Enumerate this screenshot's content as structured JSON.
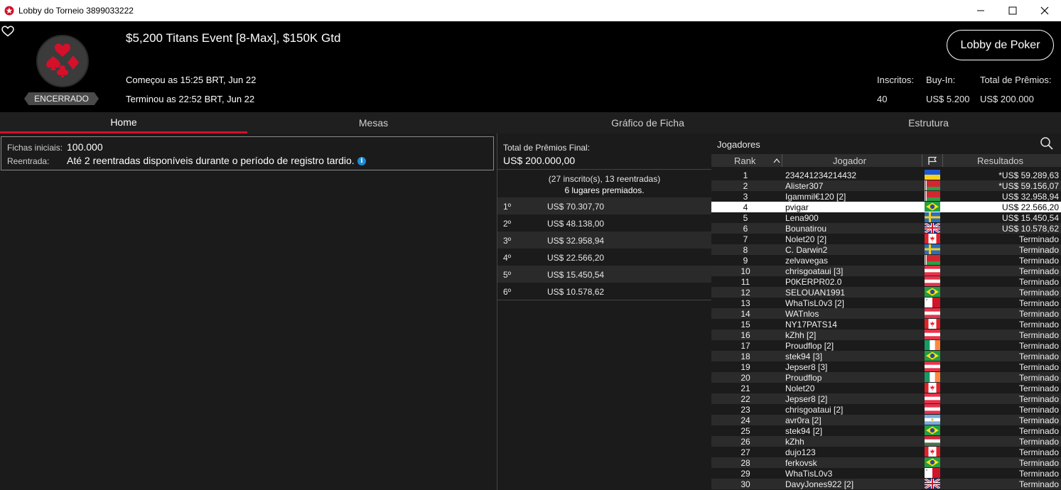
{
  "window": {
    "title": "Lobby do Torneio 3899033222"
  },
  "header": {
    "event_title": "$5,200 Titans Event [8-Max], $150K Gtd",
    "started": "Começou as 15:25 BRT, Jun 22",
    "ended": "Terminou as 22:52 BRT, Jun 22",
    "status": "ENCERRADO",
    "lobby_button": "Lobby de Poker",
    "stats": {
      "entrants_label": "Inscritos:",
      "entrants_value": "40",
      "buyin_label": "Buy-In:",
      "buyin_value": "US$ 5.200",
      "prize_label": "Total de Prêmios:",
      "prize_value": "US$ 200.000"
    }
  },
  "tabs": [
    "Home",
    "Mesas",
    "Gráfico de Ficha",
    "Estrutura"
  ],
  "info": {
    "starting_chips_label": "Fichas iniciais:",
    "starting_chips_value": "100.000",
    "reentry_label": "Reentrada:",
    "reentry_value": "Até 2 reentradas disponíveis durante o período de registro tardio."
  },
  "prizes": {
    "total_label": "Total de Prêmios Final:",
    "total_value": "US$ 200.000,00",
    "info_line1": "(27 inscrito(s), 13 reentradas)",
    "info_line2": "6 lugares premiados.",
    "places": [
      {
        "place": "1º",
        "amount": "US$ 70.307,70"
      },
      {
        "place": "2º",
        "amount": "US$ 48.138,00"
      },
      {
        "place": "3º",
        "amount": "US$ 32.958,94"
      },
      {
        "place": "4º",
        "amount": "US$ 22.566,20"
      },
      {
        "place": "5º",
        "amount": "US$ 15.450,54"
      },
      {
        "place": "6º",
        "amount": "US$ 10.578,62"
      }
    ]
  },
  "players": {
    "title": "Jogadores",
    "columns": {
      "rank": "Rank",
      "player": "Jogador",
      "results": "Resultados"
    },
    "highlight_rank": "4",
    "rows": [
      {
        "rank": "1",
        "name": "234241234214432",
        "flag": "ukraine",
        "result": "*US$ 59.289,63"
      },
      {
        "rank": "2",
        "name": "Alister307",
        "flag": "belarus",
        "result": "*US$ 59.156,07"
      },
      {
        "rank": "3",
        "name": "Igammil€120 [2]",
        "flag": "belarus",
        "result": "US$ 32.958,94"
      },
      {
        "rank": "4",
        "name": "pvigar",
        "flag": "brazil",
        "result": "US$ 22.566,20"
      },
      {
        "rank": "5",
        "name": "Lena900",
        "flag": "sweden",
        "result": "US$ 15.450,54"
      },
      {
        "rank": "6",
        "name": "Bounatirou",
        "flag": "uk",
        "result": "US$ 10.578,62"
      },
      {
        "rank": "7",
        "name": "Nolet20 [2]",
        "flag": "canada",
        "result": "Terminado"
      },
      {
        "rank": "8",
        "name": "C. Darwin2",
        "flag": "sweden",
        "result": "Terminado"
      },
      {
        "rank": "9",
        "name": "zelvavegas",
        "flag": "belarus",
        "result": "Terminado"
      },
      {
        "rank": "10",
        "name": "chrisgoataui [3]",
        "flag": "austria",
        "result": "Terminado"
      },
      {
        "rank": "11",
        "name": "P0KERPR02.0",
        "flag": "austria",
        "result": "Terminado"
      },
      {
        "rank": "12",
        "name": "SELOUAN1991",
        "flag": "brazil",
        "result": "Terminado"
      },
      {
        "rank": "13",
        "name": "WhaTisL0v3 [2]",
        "flag": "malta",
        "result": "Terminado"
      },
      {
        "rank": "14",
        "name": "WATnlos",
        "flag": "austria",
        "result": "Terminado"
      },
      {
        "rank": "15",
        "name": "NY17PATS14",
        "flag": "canada",
        "result": "Terminado"
      },
      {
        "rank": "16",
        "name": "kZhh [2]",
        "flag": "austria",
        "result": "Terminado"
      },
      {
        "rank": "17",
        "name": "Proudflop [2]",
        "flag": "ireland",
        "result": "Terminado"
      },
      {
        "rank": "18",
        "name": "stek94 [3]",
        "flag": "brazil",
        "result": "Terminado"
      },
      {
        "rank": "19",
        "name": "Jepser8 [3]",
        "flag": "austria",
        "result": "Terminado"
      },
      {
        "rank": "20",
        "name": "Proudflop",
        "flag": "ireland",
        "result": "Terminado"
      },
      {
        "rank": "21",
        "name": "Nolet20",
        "flag": "canada",
        "result": "Terminado"
      },
      {
        "rank": "22",
        "name": "Jepser8 [2]",
        "flag": "austria",
        "result": "Terminado"
      },
      {
        "rank": "23",
        "name": "chrisgoataui [2]",
        "flag": "austria",
        "result": "Terminado"
      },
      {
        "rank": "24",
        "name": "avr0ra [2]",
        "flag": "argentina",
        "result": "Terminado"
      },
      {
        "rank": "25",
        "name": "stek94 [2]",
        "flag": "brazil",
        "result": "Terminado"
      },
      {
        "rank": "26",
        "name": "kZhh",
        "flag": "hungary",
        "result": "Terminado"
      },
      {
        "rank": "27",
        "name": "dujo123",
        "flag": "canada",
        "result": "Terminado"
      },
      {
        "rank": "28",
        "name": "ferkovsk",
        "flag": "brazil",
        "result": "Terminado"
      },
      {
        "rank": "29",
        "name": "WhaTisL0v3",
        "flag": "malta",
        "result": "Terminado"
      },
      {
        "rank": "30",
        "name": "DavyJones922 [2]",
        "flag": "uk",
        "result": "Terminado"
      }
    ]
  }
}
